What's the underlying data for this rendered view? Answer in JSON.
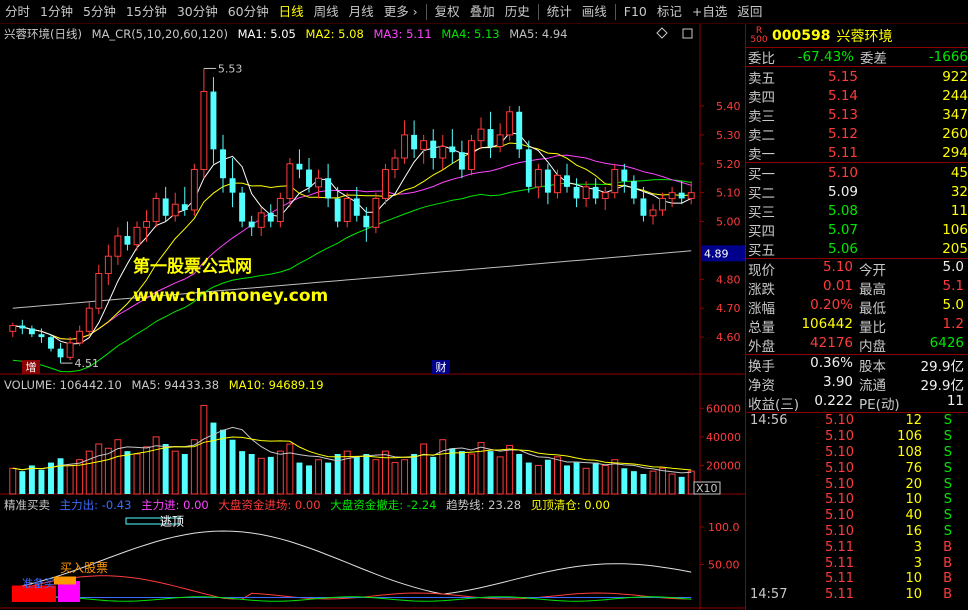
{
  "toolbar": {
    "items": [
      "分时",
      "1分钟",
      "5分钟",
      "15分钟",
      "30分钟",
      "60分钟",
      "日线",
      "周线",
      "月线",
      "更多 ›",
      "复权",
      "叠加",
      "历史",
      "统计",
      "画线",
      "F10",
      "标记",
      "+自选",
      "返回"
    ],
    "active": "日线"
  },
  "main_title": {
    "name": "兴蓉环境(日线)",
    "indicator": "MA_CR(5,10,20,60,120)",
    "ma1": "MA1: 5.05",
    "ma2": "MA2: 5.08",
    "ma3": "MA3: 5.11",
    "ma4": "MA4: 5.13",
    "ma5": "MA5: 4.94"
  },
  "colors": {
    "up": "#ff3b3b",
    "down": "#54ffff",
    "ma1": "#ffffff",
    "ma2": "#ffff00",
    "ma3": "#ff44ff",
    "ma4": "#00e600",
    "ma5": "#c0c0c0",
    "panel_border": "#8b0000"
  },
  "watermark": {
    "line1": "第一股票公式网",
    "line2": "www.chnmoney.com"
  },
  "annotations": {
    "high": "5.53",
    "low": "4.51",
    "marker_left": "增",
    "marker_mid": "财",
    "current_price_tag": "4.89"
  },
  "price_axis": [
    "5.40",
    "5.30",
    "5.20",
    "5.10",
    "5.00",
    "4.90",
    "4.80",
    "4.70",
    "4.60"
  ],
  "volume_title": {
    "label": "VOLUME: 106442.10",
    "ma5": "MA5: 94433.38",
    "ma10": "MA10: 94689.19"
  },
  "volume_axis": [
    "60000",
    "40000",
    "20000"
  ],
  "volume_unit": "X10",
  "indicator_title": {
    "name": "精准买卖",
    "zhuli_chu": "主力出: -0.43",
    "zhuli_jin": "主力进: 0.00",
    "dapan_jin": "大盘资金进场: 0.00",
    "dapan_che": "大盘资金撤走: -2.24",
    "qushi": "趋势线: 23.28",
    "jianding": "见顶清仓: 0.00"
  },
  "indicator_axis": [
    "100.0",
    "50.00"
  ],
  "indicator_labels": {
    "buy": "买入股票",
    "ready": "准备买",
    "top": "逃顶"
  },
  "quote": {
    "badge": "R 500",
    "code": "000598",
    "name": "兴蓉环境",
    "weibi": {
      "label": "委比",
      "value": "-67.43%"
    },
    "weicha": {
      "label": "委差",
      "value": "-1666"
    },
    "asks": [
      {
        "label": "卖五",
        "price": "5.15",
        "vol": "922"
      },
      {
        "label": "卖四",
        "price": "5.14",
        "vol": "244"
      },
      {
        "label": "卖三",
        "price": "5.13",
        "vol": "347"
      },
      {
        "label": "卖二",
        "price": "5.12",
        "vol": "260"
      },
      {
        "label": "卖一",
        "price": "5.11",
        "vol": "294"
      }
    ],
    "bids": [
      {
        "label": "买一",
        "price": "5.10",
        "vol": "45",
        "pc": "red"
      },
      {
        "label": "买二",
        "price": "5.09",
        "vol": "32",
        "pc": "white"
      },
      {
        "label": "买三",
        "price": "5.08",
        "vol": "11",
        "pc": "green"
      },
      {
        "label": "买四",
        "price": "5.07",
        "vol": "106",
        "pc": "green"
      },
      {
        "label": "买五",
        "price": "5.06",
        "vol": "205",
        "pc": "green"
      }
    ],
    "stats1": [
      [
        {
          "label": "现价",
          "value": "5.10",
          "c": "red"
        },
        {
          "label": "今开",
          "value": "5.0",
          "c": "white"
        }
      ],
      [
        {
          "label": "涨跌",
          "value": "0.01",
          "c": "red"
        },
        {
          "label": "最高",
          "value": "5.1",
          "c": "red"
        }
      ],
      [
        {
          "label": "涨幅",
          "value": "0.20%",
          "c": "red"
        },
        {
          "label": "最低",
          "value": "5.0",
          "c": "yellow"
        }
      ],
      [
        {
          "label": "总量",
          "value": "106442",
          "c": "yellow"
        },
        {
          "label": "量比",
          "value": "1.2",
          "c": "red"
        }
      ],
      [
        {
          "label": "外盘",
          "value": "42176",
          "c": "red"
        },
        {
          "label": "内盘",
          "value": "6426",
          "c": "green"
        }
      ]
    ],
    "stats2": [
      [
        {
          "label": "换手",
          "value": "0.36%",
          "c": "white"
        },
        {
          "label": "股本",
          "value": "29.9亿",
          "c": "white"
        }
      ],
      [
        {
          "label": "净资",
          "value": "3.90",
          "c": "white"
        },
        {
          "label": "流通",
          "value": "29.9亿",
          "c": "white"
        }
      ],
      [
        {
          "label": "收益(三)",
          "value": "0.222",
          "c": "white"
        },
        {
          "label": "PE(动)",
          "value": "11",
          "c": "white"
        }
      ]
    ],
    "ticks": [
      {
        "time": "14:56",
        "price": "5.10",
        "vol": "12",
        "bs": "S"
      },
      {
        "time": "",
        "price": "5.10",
        "vol": "106",
        "bs": "S"
      },
      {
        "time": "",
        "price": "5.10",
        "vol": "108",
        "bs": "S"
      },
      {
        "time": "",
        "price": "5.10",
        "vol": "76",
        "bs": "S"
      },
      {
        "time": "",
        "price": "5.10",
        "vol": "20",
        "bs": "S"
      },
      {
        "time": "",
        "price": "5.10",
        "vol": "10",
        "bs": "S"
      },
      {
        "time": "",
        "price": "5.10",
        "vol": "40",
        "bs": "S"
      },
      {
        "time": "",
        "price": "5.10",
        "vol": "16",
        "bs": "S"
      },
      {
        "time": "",
        "price": "5.11",
        "vol": "3",
        "bs": "B"
      },
      {
        "time": "",
        "price": "5.11",
        "vol": "3",
        "bs": "B"
      },
      {
        "time": "",
        "price": "5.11",
        "vol": "10",
        "bs": "B"
      },
      {
        "time": "14:57",
        "price": "5.11",
        "vol": "10",
        "bs": "B"
      }
    ]
  },
  "chart_data": {
    "type": "candlestick",
    "y_range": [
      4.5,
      5.58
    ],
    "candles": [
      [
        4.62,
        4.65,
        4.6,
        4.64
      ],
      [
        4.64,
        4.66,
        4.61,
        4.63
      ],
      [
        4.63,
        4.64,
        4.6,
        4.61
      ],
      [
        4.61,
        4.63,
        4.58,
        4.6
      ],
      [
        4.6,
        4.61,
        4.55,
        4.56
      ],
      [
        4.56,
        4.58,
        4.51,
        4.53
      ],
      [
        4.53,
        4.6,
        4.52,
        4.58
      ],
      [
        4.58,
        4.64,
        4.57,
        4.62
      ],
      [
        4.62,
        4.72,
        4.6,
        4.7
      ],
      [
        4.7,
        4.85,
        4.68,
        4.82
      ],
      [
        4.82,
        4.92,
        4.78,
        4.88
      ],
      [
        4.88,
        4.98,
        4.85,
        4.95
      ],
      [
        4.95,
        5.0,
        4.9,
        4.92
      ],
      [
        4.92,
        5.0,
        4.9,
        4.98
      ],
      [
        4.98,
        5.04,
        4.93,
        5.0
      ],
      [
        5.0,
        5.1,
        4.98,
        5.08
      ],
      [
        5.08,
        5.12,
        5.0,
        5.02
      ],
      [
        5.02,
        5.1,
        5.0,
        5.06
      ],
      [
        5.06,
        5.12,
        5.02,
        5.04
      ],
      [
        5.04,
        5.2,
        5.02,
        5.18
      ],
      [
        5.18,
        5.53,
        5.15,
        5.45
      ],
      [
        5.45,
        5.5,
        5.2,
        5.25
      ],
      [
        5.25,
        5.3,
        5.1,
        5.15
      ],
      [
        5.15,
        5.22,
        5.05,
        5.1
      ],
      [
        5.1,
        5.12,
        4.98,
        5.0
      ],
      [
        5.0,
        5.02,
        4.95,
        4.98
      ],
      [
        4.98,
        5.05,
        4.95,
        5.03
      ],
      [
        5.03,
        5.06,
        4.98,
        5.0
      ],
      [
        5.0,
        5.1,
        4.98,
        5.08
      ],
      [
        5.08,
        5.22,
        5.05,
        5.2
      ],
      [
        5.2,
        5.25,
        5.15,
        5.18
      ],
      [
        5.18,
        5.22,
        5.1,
        5.12
      ],
      [
        5.12,
        5.18,
        5.08,
        5.15
      ],
      [
        5.15,
        5.2,
        5.05,
        5.08
      ],
      [
        5.08,
        5.12,
        4.98,
        5.0
      ],
      [
        5.0,
        5.1,
        4.98,
        5.08
      ],
      [
        5.08,
        5.12,
        5.0,
        5.02
      ],
      [
        5.02,
        5.05,
        4.93,
        4.98
      ],
      [
        4.98,
        5.1,
        4.96,
        5.08
      ],
      [
        5.08,
        5.2,
        5.06,
        5.18
      ],
      [
        5.18,
        5.25,
        5.15,
        5.22
      ],
      [
        5.22,
        5.35,
        5.2,
        5.3
      ],
      [
        5.3,
        5.35,
        5.22,
        5.25
      ],
      [
        5.25,
        5.3,
        5.2,
        5.28
      ],
      [
        5.28,
        5.32,
        5.18,
        5.22
      ],
      [
        5.22,
        5.3,
        5.18,
        5.26
      ],
      [
        5.26,
        5.32,
        5.2,
        5.24
      ],
      [
        5.24,
        5.28,
        5.15,
        5.18
      ],
      [
        5.18,
        5.3,
        5.16,
        5.28
      ],
      [
        5.28,
        5.36,
        5.25,
        5.32
      ],
      [
        5.32,
        5.38,
        5.22,
        5.26
      ],
      [
        5.26,
        5.34,
        5.24,
        5.3
      ],
      [
        5.3,
        5.4,
        5.28,
        5.38
      ],
      [
        5.38,
        5.4,
        5.22,
        5.25
      ],
      [
        5.25,
        5.28,
        5.1,
        5.12
      ],
      [
        5.12,
        5.2,
        5.08,
        5.18
      ],
      [
        5.18,
        5.2,
        5.06,
        5.1
      ],
      [
        5.1,
        5.18,
        5.08,
        5.16
      ],
      [
        5.16,
        5.2,
        5.1,
        5.12
      ],
      [
        5.12,
        5.15,
        5.05,
        5.08
      ],
      [
        5.08,
        5.14,
        5.05,
        5.12
      ],
      [
        5.12,
        5.15,
        5.06,
        5.08
      ],
      [
        5.08,
        5.12,
        5.04,
        5.1
      ],
      [
        5.1,
        5.2,
        5.08,
        5.18
      ],
      [
        5.18,
        5.2,
        5.1,
        5.14
      ],
      [
        5.14,
        5.16,
        5.06,
        5.08
      ],
      [
        5.08,
        5.12,
        5.0,
        5.02
      ],
      [
        5.02,
        5.06,
        4.99,
        5.04
      ],
      [
        5.04,
        5.1,
        5.02,
        5.08
      ],
      [
        5.08,
        5.12,
        5.05,
        5.1
      ],
      [
        5.1,
        5.14,
        5.06,
        5.08
      ],
      [
        5.08,
        5.14,
        5.06,
        5.1
      ]
    ],
    "volumes": [
      18,
      16,
      20,
      17,
      22,
      25,
      20,
      24,
      30,
      35,
      32,
      38,
      30,
      28,
      33,
      40,
      35,
      30,
      28,
      38,
      62,
      50,
      45,
      38,
      30,
      28,
      25,
      26,
      30,
      35,
      22,
      20,
      24,
      22,
      28,
      30,
      26,
      28,
      24,
      30,
      22,
      24,
      28,
      35,
      26,
      38,
      32,
      30,
      28,
      36,
      30,
      26,
      34,
      28,
      22,
      20,
      24,
      26,
      20,
      22,
      18,
      22,
      20,
      24,
      18,
      16,
      14,
      16,
      18,
      14,
      12,
      16
    ]
  }
}
